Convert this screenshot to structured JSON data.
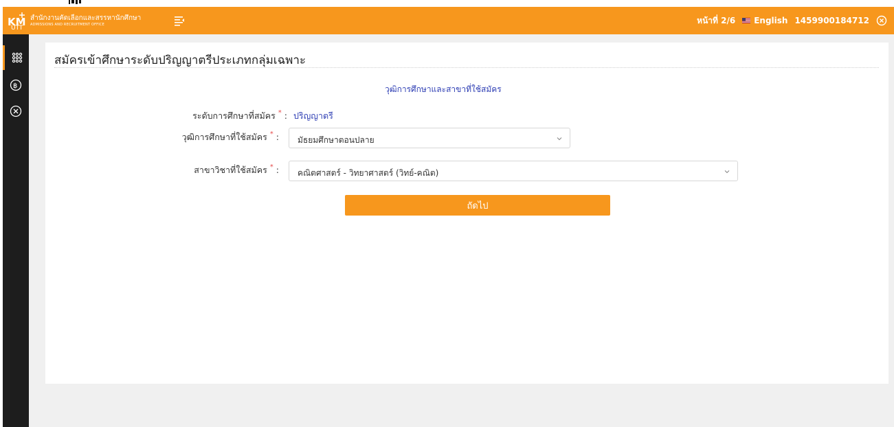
{
  "header": {
    "org_name_th": "สำนักงานคัดเลือกและสรรหานักศึกษา",
    "org_name_en": "ADMISSIONS AND RECRUITMENT OFFICE",
    "page_indicator": "หน้าที่ 2/6",
    "language_label": "English",
    "user_id": "1459900184712"
  },
  "sidebar": {
    "items": [
      {
        "icon": "apps-grid-icon",
        "active": true
      },
      {
        "icon": "baht-coin-icon",
        "active": false
      },
      {
        "icon": "close-circle-icon",
        "active": false
      }
    ]
  },
  "main": {
    "page_title": "สมัครเข้าศึกษาระดับปริญญาตรีประเภทกลุ่มเฉพาะ",
    "section_title": "วุฒิการศึกษาและสาขาที่ใช้สมัคร",
    "level_label": "ระดับการศึกษาที่สมัคร",
    "level_value": "ปริญญาตรี",
    "qualification_label": "วุฒิการศึกษาที่ใช้สมัคร",
    "qualification_value": "มัธยมศึกษาตอนปลาย",
    "major_label": "สาขาวิชาที่ใช้สมัคร",
    "major_value": "คณิตศาสตร์ - วิทยาศาสตร์ (วิทย์-คณิต)",
    "required_mark": "*",
    "colon": ":",
    "next_button": "ถัดไป"
  },
  "colors": {
    "accent": "#f7971d",
    "sidebar": "#1d1d1d",
    "link_blue": "#2f3fb4",
    "required_red": "#e64c4c"
  }
}
